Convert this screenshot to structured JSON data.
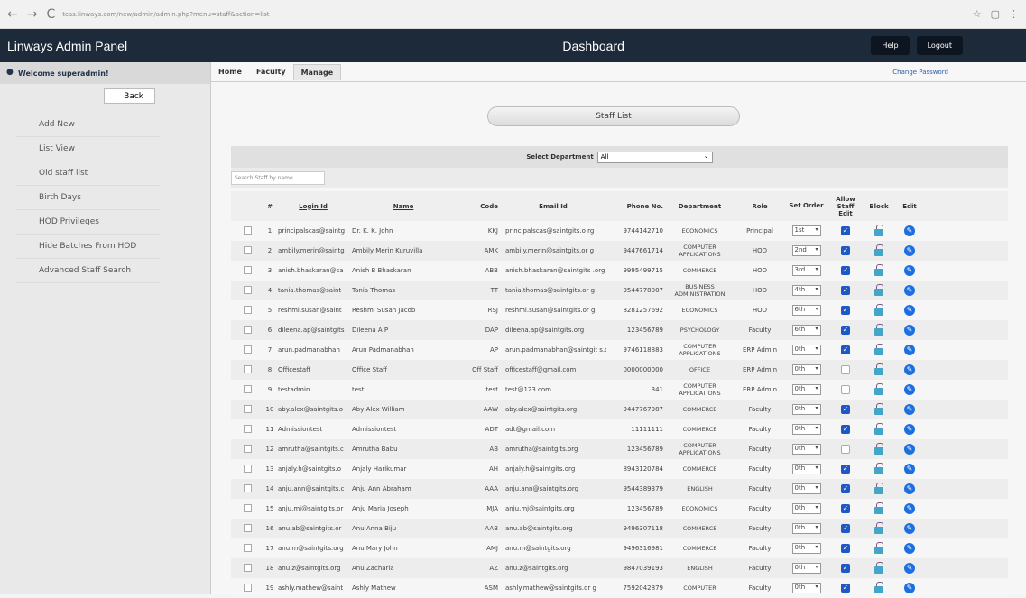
{
  "browser": {
    "url": "tcas.linways.com/new/admin/admin.php?menu=staff&action=list"
  },
  "header": {
    "brand": "Linways Admin Panel",
    "title": "Dashboard",
    "help_label": "Help",
    "logout_label": "Logout"
  },
  "sidebar": {
    "welcome": "Welcome superadmin!",
    "back_label": "Back",
    "items": [
      "Add New",
      "List View",
      "Old staff list",
      "Birth Days",
      "HOD Privileges",
      "Hide Batches From HOD",
      "Advanced Staff Search"
    ]
  },
  "tabs": [
    "Home",
    "Faculty",
    "Manage"
  ],
  "change_password": "Change Password",
  "page": {
    "heading": "Staff List",
    "dept_label": "Select Department",
    "dept_value": "All",
    "search_placeholder": "Search Staff by name"
  },
  "table": {
    "headers": [
      "#",
      "Login Id",
      "Name",
      "Code",
      "Email Id",
      "Phone No.",
      "Department",
      "Role",
      "Set Order",
      "Allow Staff Edit",
      "Block",
      "Edit"
    ],
    "rows": [
      {
        "n": "1",
        "login": "principalscas@saintg",
        "name": "Dr. K. K. John",
        "code": "KKJ",
        "email": "principalscas@saintgits.o rg",
        "phone": "9744142710",
        "dept": "ECONOMICS",
        "role": "Principal",
        "order": "1st",
        "allow": true
      },
      {
        "n": "2",
        "login": "ambily.merin@saintg",
        "name": "Ambily Merin Kuruvilla",
        "code": "AMK",
        "email": "ambily.merin@saintgits.or g",
        "phone": "9447661714",
        "dept": "COMPUTER APPLICATIONS",
        "role": "HOD",
        "order": "2nd",
        "allow": true
      },
      {
        "n": "3",
        "login": "anish.bhaskaran@sa",
        "name": "Anish B Bhaskaran",
        "code": "ABB",
        "email": "anish.bhaskaran@saintgits .org",
        "phone": "9995499715",
        "dept": "COMMERCE",
        "role": "HOD",
        "order": "3rd",
        "allow": true
      },
      {
        "n": "4",
        "login": "tania.thomas@saint",
        "name": "Tania Thomas",
        "code": "TT",
        "email": "tania.thomas@saintgits.or g",
        "phone": "9544778007",
        "dept": "BUSINESS ADMINISTRATION",
        "role": "HOD",
        "order": "4th",
        "allow": true
      },
      {
        "n": "5",
        "login": "reshmi.susan@saint",
        "name": "Reshmi Susan Jacob",
        "code": "RSJ",
        "email": "reshmi.susan@saintgits.or g",
        "phone": "8281257692",
        "dept": "ECONOMICS",
        "role": "HOD",
        "order": "6th",
        "allow": true
      },
      {
        "n": "6",
        "login": "dileena.ap@saintgits",
        "name": "Dileena A P",
        "code": "DAP",
        "email": "dileena.ap@saintgits.org",
        "phone": "123456789",
        "dept": "PSYCHOLOGY",
        "role": "Faculty",
        "order": "6th",
        "allow": true
      },
      {
        "n": "7",
        "login": "arun.padmanabhan",
        "name": "Arun Padmanabhan",
        "code": "AP",
        "email": "arun.padmanabhan@saintgit s.org",
        "phone": "9746118883",
        "dept": "COMPUTER APPLICATIONS",
        "role": "ERP Admin",
        "order": "0th",
        "allow": true
      },
      {
        "n": "8",
        "login": "Officestaff",
        "name": "Office Staff",
        "code": "Off Staff",
        "email": "officestaff@gmail.com",
        "phone": "0000000000",
        "dept": "OFFICE",
        "role": "ERP Admin",
        "order": "0th",
        "allow": false
      },
      {
        "n": "9",
        "login": "testadmin",
        "name": "test",
        "code": "test",
        "email": "test@123.com",
        "phone": "341",
        "dept": "COMPUTER APPLICATIONS",
        "role": "ERP Admin",
        "order": "0th",
        "allow": false
      },
      {
        "n": "10",
        "login": "aby.alex@saintgits.o",
        "name": "Aby Alex William",
        "code": "AAW",
        "email": "aby.alex@saintgits.org",
        "phone": "9447767987",
        "dept": "COMMERCE",
        "role": "Faculty",
        "order": "0th",
        "allow": true
      },
      {
        "n": "11",
        "login": "Admissiontest",
        "name": "Admissiontest",
        "code": "ADT",
        "email": "adt@gmail.com",
        "phone": "11111111",
        "dept": "COMMERCE",
        "role": "Faculty",
        "order": "0th",
        "allow": true
      },
      {
        "n": "12",
        "login": "amrutha@saintgits.c",
        "name": "Amrutha Babu",
        "code": "AB",
        "email": "amrutha@saintgits.org",
        "phone": "123456789",
        "dept": "COMPUTER APPLICATIONS",
        "role": "Faculty",
        "order": "0th",
        "allow": false
      },
      {
        "n": "13",
        "login": "anjaly.h@saintgits.o",
        "name": "Anjaly Harikumar",
        "code": "AH",
        "email": "anjaly.h@saintgits.org",
        "phone": "8943120784",
        "dept": "COMMERCE",
        "role": "Faculty",
        "order": "0th",
        "allow": true
      },
      {
        "n": "14",
        "login": "anju.ann@saintgits.c",
        "name": "Anju Ann Abraham",
        "code": "AAA",
        "email": "anju.ann@saintgits.org",
        "phone": "9544389379",
        "dept": "ENGLISH",
        "role": "Faculty",
        "order": "0th",
        "allow": true
      },
      {
        "n": "15",
        "login": "anju.mj@saintgits.or",
        "name": "Anju Maria Joseph",
        "code": "MJA",
        "email": "anju.mj@saintgits.org",
        "phone": "123456789",
        "dept": "ECONOMICS",
        "role": "Faculty",
        "order": "0th",
        "allow": true
      },
      {
        "n": "16",
        "login": "anu.ab@saintgits.or",
        "name": "Anu Anna Biju",
        "code": "AAB",
        "email": "anu.ab@saintgits.org",
        "phone": "9496307118",
        "dept": "COMMERCE",
        "role": "Faculty",
        "order": "0th",
        "allow": true
      },
      {
        "n": "17",
        "login": "anu.m@saintgits.org",
        "name": "Anu Mary John",
        "code": "AMJ",
        "email": "anu.m@saintgits.org",
        "phone": "9496316981",
        "dept": "COMMERCE",
        "role": "Faculty",
        "order": "0th",
        "allow": true
      },
      {
        "n": "18",
        "login": "anu.z@saintgits.org",
        "name": "Anu Zacharia",
        "code": "AZ",
        "email": "anu.z@saintgits.org",
        "phone": "9847039193",
        "dept": "ENGLISH",
        "role": "Faculty",
        "order": "0th",
        "allow": true
      },
      {
        "n": "19",
        "login": "ashly.mathew@saint",
        "name": "Ashly Mathew",
        "code": "ASM",
        "email": "ashly.mathew@saintgits.or g",
        "phone": "7592042879",
        "dept": "COMPUTER",
        "role": "Faculty",
        "order": "0th",
        "allow": true
      }
    ]
  }
}
